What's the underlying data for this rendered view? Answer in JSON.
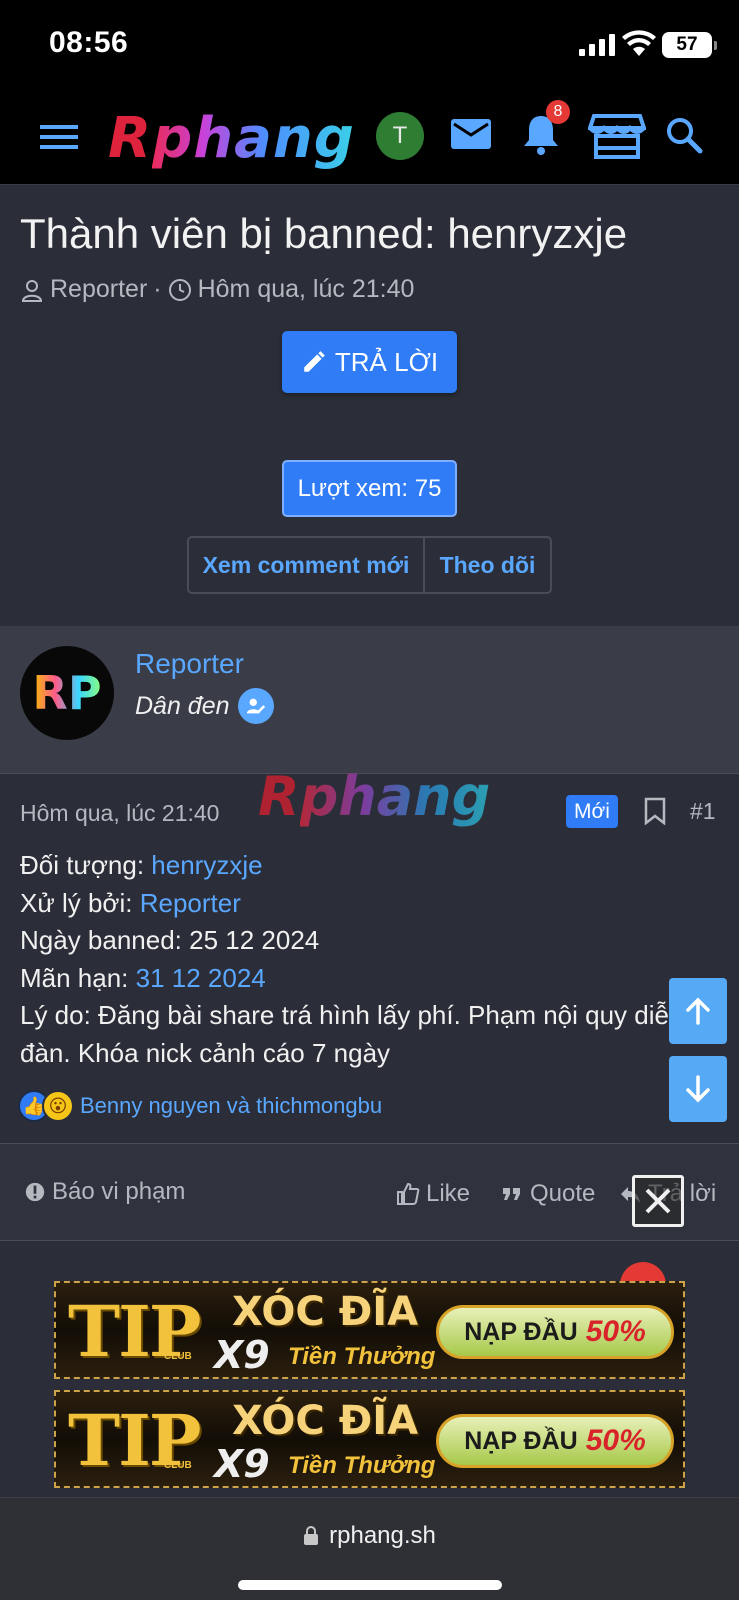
{
  "status_bar": {
    "time": "08:56",
    "battery": "57"
  },
  "nav": {
    "logo_first": "R",
    "logo_rest": "phang",
    "avatar_letter": "T",
    "notification_count": "8"
  },
  "thread": {
    "title": "Thành viên bị banned: henryzxje",
    "author": "Reporter",
    "separator": "·",
    "time": "Hôm qua, lúc 21:40",
    "reply_button": "TRẢ LỜI",
    "views": "Lượt xem: 75",
    "new_comments_button": "Xem comment mới",
    "follow_button": "Theo dõi"
  },
  "user": {
    "avatar_text": "RP",
    "name": "Reporter",
    "title": "Dân đen"
  },
  "post": {
    "date": "Hôm qua, lúc 21:40",
    "watermark_first": "R",
    "watermark_rest": "phang",
    "new_badge": "Mới",
    "number": "#1",
    "lines": {
      "subject_label": "Đối tượng: ",
      "subject_value": "henryzxje",
      "handled_label": "Xử lý bởi: ",
      "handled_value": "Reporter",
      "banned_label": "Ngày banned: ",
      "banned_value": "25 12 2024",
      "expiry_label": "Mãn hạn: ",
      "expiry_value": "31 12 2024",
      "reason": "Lý do: Đăng bài share trá hình lấy phí. Phạm nội quy diễn đàn. Khóa nick cảnh cáo 7 ngày"
    },
    "reactions_text": "Benny nguyen và thichmongbu"
  },
  "actions": {
    "report": "Báo vi phạm",
    "like": "Like",
    "quote": "Quote",
    "reply": "Trả lời"
  },
  "ads": [
    {
      "brand": "TIP",
      "club": "CLUB",
      "headline": "XÓC ĐĨA",
      "sub1": "X9",
      "sub2": "Tiền Thưởng",
      "cta_label": "NẠP ĐẦU",
      "cta_value": "50%"
    },
    {
      "brand": "TIP",
      "club": "CLUB",
      "headline": "XÓC ĐĨA",
      "sub1": "X9",
      "sub2": "Tiền Thưởng",
      "cta_label": "NẠP ĐẦU",
      "cta_value": "50%"
    }
  ],
  "browser": {
    "url": "rphang.sh"
  },
  "colors": {
    "accent": "#2f7cf6",
    "link": "#5aa7ff",
    "background": "#2b2e38"
  },
  "icons": [
    "hamburger-icon",
    "avatar",
    "mail-icon",
    "bell-icon",
    "store-icon",
    "search-icon",
    "user-icon",
    "clock-icon",
    "pencil-icon",
    "edit-badge-icon",
    "bookmark-icon",
    "like-icon",
    "quote-icon",
    "reply-icon",
    "alert-icon",
    "arrow-up-icon",
    "arrow-down-icon",
    "close-icon",
    "lock-icon"
  ]
}
